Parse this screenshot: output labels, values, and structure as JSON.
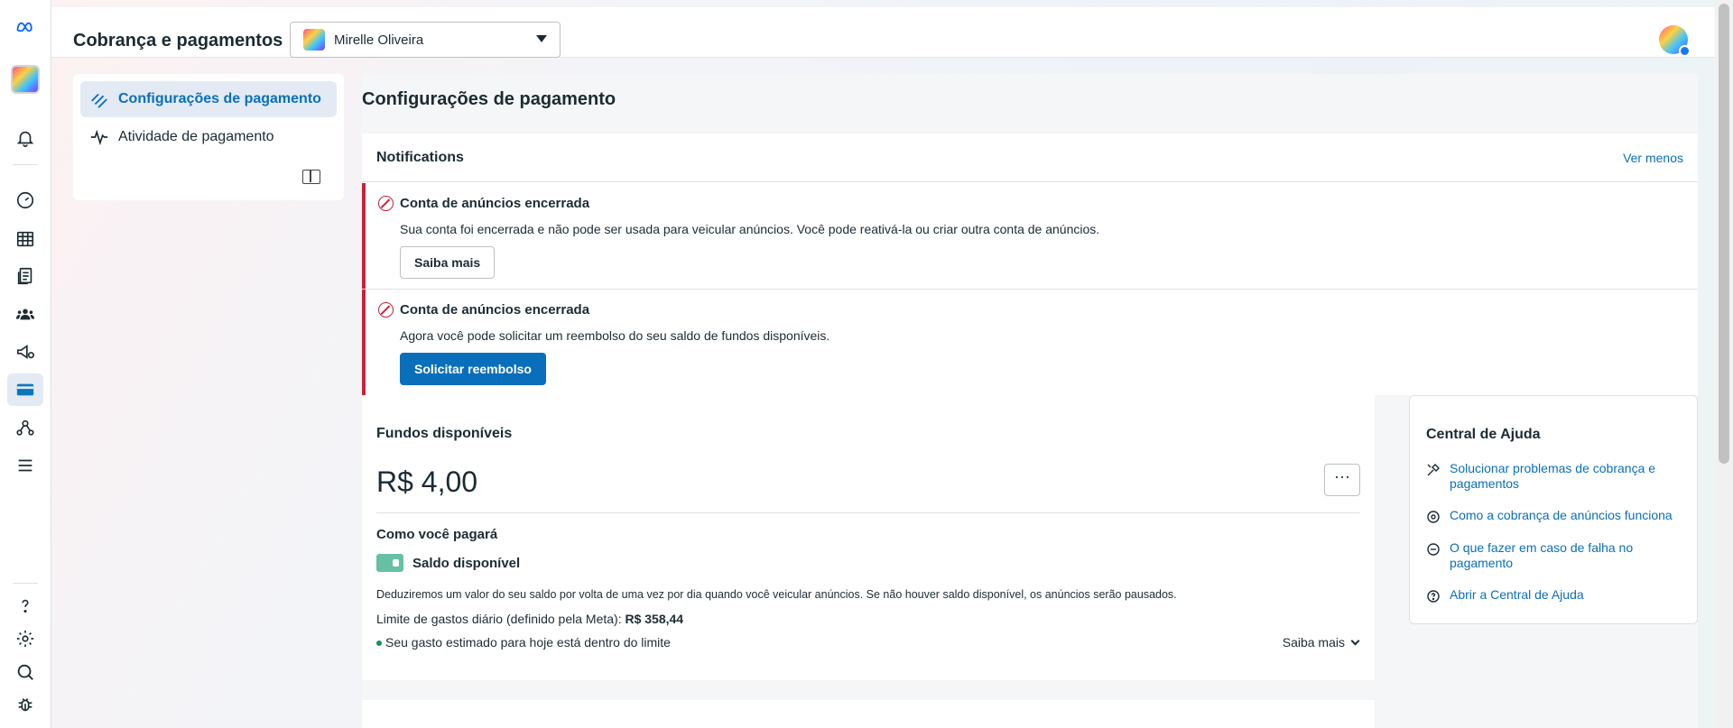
{
  "app": {
    "page_title": "Cobrança e pagamentos",
    "account_selector": {
      "value": "Mirelle Oliveira"
    }
  },
  "sidebar": {
    "items": [
      {
        "label": "Configurações de pagamento",
        "active": true
      },
      {
        "label": "Atividade de pagamento",
        "active": false
      }
    ]
  },
  "main": {
    "title": "Configurações de pagamento",
    "notifications": {
      "header": "Notifications",
      "toggle_link": "Ver menos",
      "items": [
        {
          "title": "Conta de anúncios encerrada",
          "description": "Sua conta foi encerrada e não pode ser usada para veicular anúncios. Você pode reativá-la ou criar outra conta de anúncios.",
          "button": "Saiba mais"
        },
        {
          "title": "Conta de anúncios encerrada",
          "description": "Agora você pode solicitar um reembolso do seu saldo de fundos disponíveis.",
          "button": "Solicitar reembolso"
        }
      ]
    },
    "funds": {
      "title": "Fundos disponíveis",
      "amount": "R$ 4,00",
      "more_label": "···",
      "how_you_pay": "Como você pagará",
      "method": "Saldo disponível",
      "description": "Deduziremos um valor do seu saldo por volta de uma vez por dia quando você veicular anúncios. Se não houver saldo disponível, os anúncios serão pausados.",
      "limit_label": "Limite de gastos diário (definido pela Meta): ",
      "limit_value": "R$ 358,44",
      "estimate": "Seu gasto estimado para hoje está dentro do limite",
      "learn_more": "Saiba mais"
    },
    "help": {
      "title": "Central de Ajuda",
      "links": [
        {
          "label": "Solucionar problemas de cobrança e pagamentos",
          "icon": "tools-icon"
        },
        {
          "label": "Como a cobrança de anúncios funciona",
          "icon": "settings-cycle-icon"
        },
        {
          "label": "O que fazer em caso de falha no pagamento",
          "icon": "minus-circle-icon"
        },
        {
          "label": "Abrir a Central de Ajuda",
          "icon": "question-circle-icon"
        }
      ]
    }
  },
  "rail": {
    "icons": [
      "meta-logo-icon",
      "account-avatar",
      "notifications-bell-icon",
      "dashboard-gauge-icon",
      "table-grid-icon",
      "pages-icon",
      "audience-people-icon",
      "campaign-megaphone-icon",
      "billing-card-icon",
      "business-network-icon",
      "menu-icon",
      "help-question-icon",
      "settings-gear-icon",
      "search-icon",
      "bug-icon"
    ]
  },
  "colors": {
    "accent": "#0a6fbb",
    "error": "#c4233a",
    "success_dot": "#1a8f5a",
    "wallet": "#67bfa4"
  }
}
